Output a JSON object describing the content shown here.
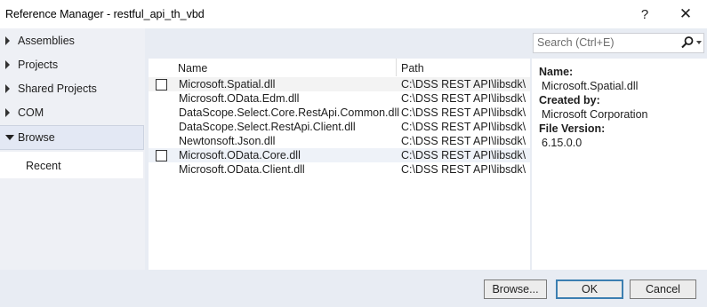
{
  "window": {
    "title": "Reference Manager - restful_api_th_vbd",
    "help_glyph": "?",
    "close_glyph": "✕"
  },
  "sidebar": {
    "items": [
      {
        "label": "Assemblies",
        "expanded": false
      },
      {
        "label": "Projects",
        "expanded": false
      },
      {
        "label": "Shared Projects",
        "expanded": false
      },
      {
        "label": "COM",
        "expanded": false
      },
      {
        "label": "Browse",
        "expanded": true,
        "selected": true
      }
    ],
    "sub_items": [
      {
        "label": "Recent"
      }
    ]
  },
  "search": {
    "placeholder": "Search (Ctrl+E)",
    "value": ""
  },
  "table": {
    "columns": [
      "Name",
      "Path"
    ],
    "rows": [
      {
        "name": "Microsoft.Spatial.dll",
        "path": "C:\\DSS REST API\\libsdk\\...",
        "checkbox": true,
        "checked": false
      },
      {
        "name": "Microsoft.OData.Edm.dll",
        "path": "C:\\DSS REST API\\libsdk\\...",
        "checkbox": false
      },
      {
        "name": "DataScope.Select.Core.RestApi.Common.dll",
        "path": "C:\\DSS REST API\\libsdk\\...",
        "checkbox": false
      },
      {
        "name": "DataScope.Select.RestApi.Client.dll",
        "path": "C:\\DSS REST API\\libsdk\\...",
        "checkbox": false
      },
      {
        "name": "Newtonsoft.Json.dll",
        "path": "C:\\DSS REST API\\libsdk\\...",
        "checkbox": false
      },
      {
        "name": "Microsoft.OData.Core.dll",
        "path": "C:\\DSS REST API\\libsdk\\...",
        "checkbox": true,
        "checked": false
      },
      {
        "name": "Microsoft.OData.Client.dll",
        "path": "C:\\DSS REST API\\libsdk\\...",
        "checkbox": false
      }
    ]
  },
  "details": {
    "name_label": "Name:",
    "name_value": "Microsoft.Spatial.dll",
    "created_label": "Created by:",
    "created_value": "Microsoft Corporation",
    "version_label": "File Version:",
    "version_value": "6.15.0.0"
  },
  "footer": {
    "browse_label": "Browse...",
    "ok_label": "OK",
    "cancel_label": "Cancel"
  },
  "colors": {
    "background": "#e8ecf3",
    "ok_border": "#3c7fb1",
    "selected_nav": "#e3e8f4"
  }
}
